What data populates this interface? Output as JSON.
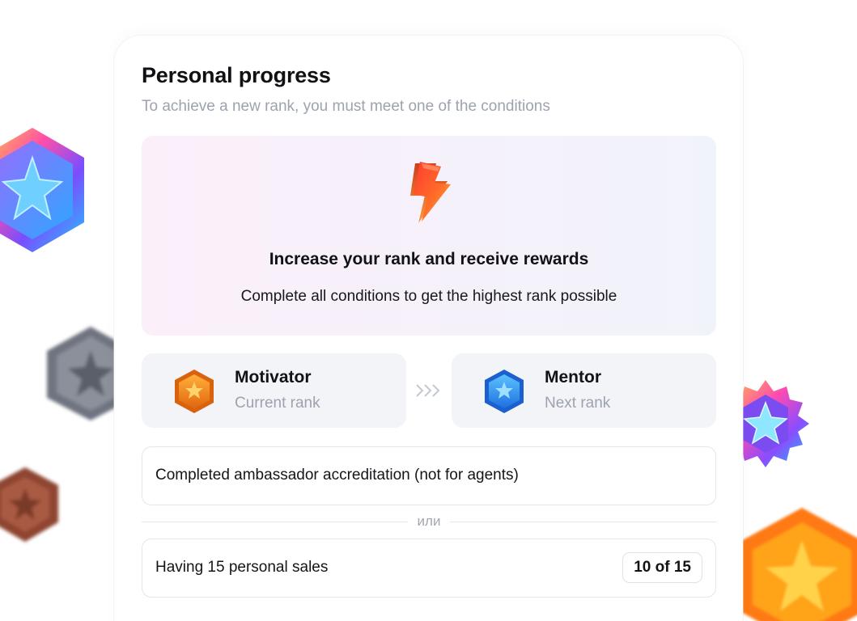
{
  "header": {
    "title": "Personal progress",
    "subtitle": "To achieve a new rank, you must meet one of the conditions"
  },
  "hero": {
    "icon": "lightning-bolt-icon",
    "heading": "Increase your rank and receive rewards",
    "text": "Complete all conditions to get the highest rank possible"
  },
  "ranks": {
    "current": {
      "name": "Motivator",
      "label": "Current rank",
      "icon": "bronze-star-badge-icon"
    },
    "next": {
      "name": "Mentor",
      "label": "Next rank",
      "icon": "blue-star-badge-icon"
    }
  },
  "conditions": {
    "items": [
      {
        "text": "Completed ambassador accreditation (not for agents)"
      },
      {
        "text": "Having 15 personal sales",
        "progress": "10 of 15"
      }
    ],
    "separator": "или"
  },
  "colors": {
    "accent_orange": "#f08a1c",
    "accent_blue": "#2f8ff0",
    "muted_text": "#9da3ae"
  }
}
